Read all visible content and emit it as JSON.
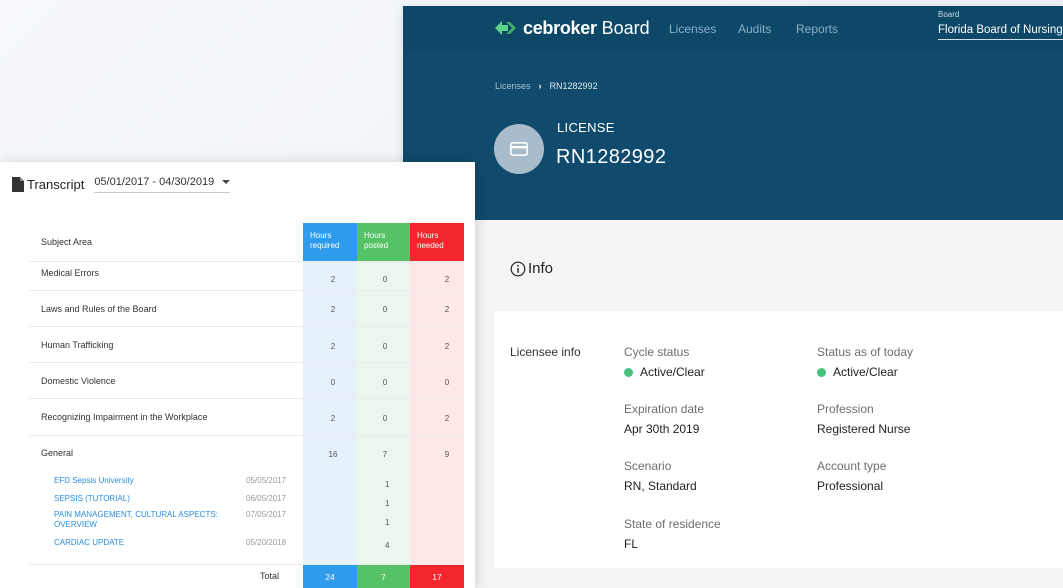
{
  "nav": {
    "brand": "cebroker",
    "brand_suffix": "Board",
    "links": [
      "Licenses",
      "Audits",
      "Reports"
    ],
    "board_label": "Board",
    "board_value": "Florida Board of Nursing"
  },
  "breadcrumb": {
    "parent": "Licenses",
    "separator": "›",
    "current": "RN1282992"
  },
  "license": {
    "label": "LICENSE",
    "number": "RN1282992"
  },
  "info": {
    "heading": "Info",
    "section_label": "Licensee info",
    "fields": {
      "cycle_status": {
        "label": "Cycle status",
        "value": "Active/Clear",
        "status_color": "#46c17b"
      },
      "status_today": {
        "label": "Status as of today",
        "value": "Active/Clear",
        "status_color": "#46c17b"
      },
      "expiration": {
        "label": "Expiration date",
        "value": "Apr 30th 2019"
      },
      "profession": {
        "label": "Profession",
        "value": "Registered Nurse"
      },
      "scenario": {
        "label": "Scenario",
        "value": "RN, Standard"
      },
      "account_type": {
        "label": "Account type",
        "value": "Professional"
      },
      "state": {
        "label": "State of residence",
        "value": "FL"
      }
    }
  },
  "transcript": {
    "title": "Transcript",
    "range": "05/01/2017 - 04/30/2019",
    "columns": {
      "subject": "Subject Area",
      "required": [
        "Hours",
        "required"
      ],
      "posted": [
        "Hours",
        "posted"
      ],
      "needed": [
        "Hours",
        "needed"
      ]
    },
    "rows": [
      {
        "subject": "Medical Errors",
        "required": "2",
        "posted": "0",
        "needed": "2"
      },
      {
        "subject": "Laws and Rules of the Board",
        "required": "2",
        "posted": "0",
        "needed": "2"
      },
      {
        "subject": "Human Trafficking",
        "required": "2",
        "posted": "0",
        "needed": "2"
      },
      {
        "subject": "Domestic Violence",
        "required": "0",
        "posted": "0",
        "needed": "0"
      },
      {
        "subject": "Recognizing Impairment in the Workplace",
        "required": "2",
        "posted": "0",
        "needed": "2"
      },
      {
        "subject": "General",
        "required": "16",
        "posted": "7",
        "needed": "9"
      }
    ],
    "courses": [
      {
        "name": "EFD Sepsis University",
        "date": "05/05/2017",
        "hours": "1"
      },
      {
        "name": "SEPSIS (TUTORIAL)",
        "date": "06/05/2017",
        "hours": "1"
      },
      {
        "name_lines": [
          "PAIN MANAGEMENT, CULTURAL ASPECTS:",
          "OVERVIEW"
        ],
        "date": "07/05/2017",
        "hours": "1"
      },
      {
        "name": "CARDIAC UPDATE",
        "date": "05/20/2018",
        "hours": "4"
      }
    ],
    "total": {
      "label": "Total",
      "required": "24",
      "posted": "7",
      "needed": "17"
    },
    "colors": {
      "required": "#2f9bec",
      "posted": "#56c266",
      "needed": "#f3262e"
    }
  },
  "colors": {
    "nav_bg": "#0e4868",
    "hero_bg": "#104a6c",
    "logo_green": "#5fd38a"
  }
}
